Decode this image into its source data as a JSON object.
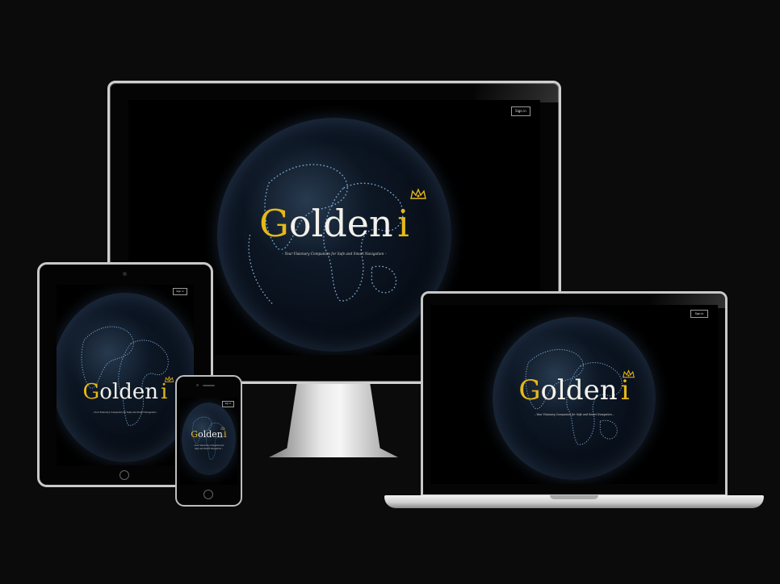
{
  "brand": {
    "first_letter": "G",
    "rest": "olden",
    "suffix": "i",
    "tagline": "– Your Visionary Companion for Safe and Smart Navigation –",
    "tagline_phone": "– Your Visionary Companion for",
    "tagline_phone_2": "Safe and Smart Navigation –"
  },
  "nav": {
    "signin_label": "Sign in"
  },
  "colors": {
    "gold": "#e6b818",
    "background": "#0c0b0c",
    "screen": "#000000"
  },
  "icons": {
    "crown": "crown-icon",
    "home_button": "home-button-icon"
  }
}
